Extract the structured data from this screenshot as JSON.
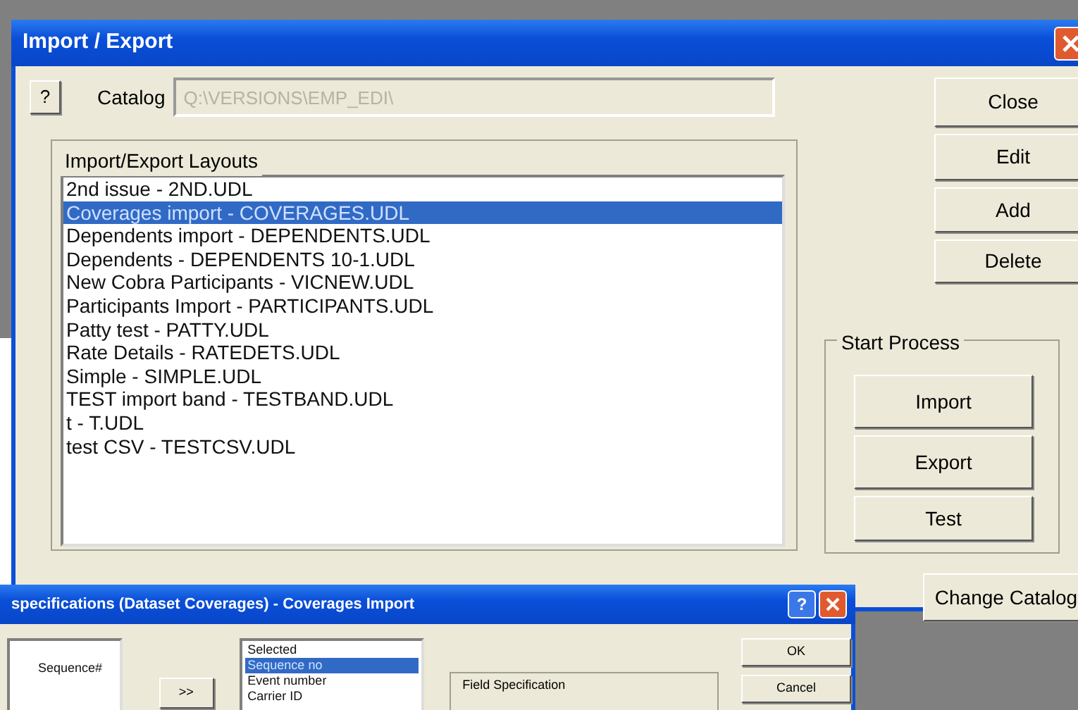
{
  "dialog": {
    "title": "Import / Export",
    "help_button": "?",
    "catalog": {
      "label": "Catalog",
      "value": "Q:\\VERSIONS\\EMP_EDI\\",
      "disabled": true
    },
    "layouts": {
      "title": "Import/Export Layouts",
      "items": [
        {
          "label": "2nd issue - 2ND.UDL",
          "selected": false
        },
        {
          "label": "Coverages import - COVERAGES.UDL",
          "selected": true
        },
        {
          "label": "Dependents import - DEPENDENTS.UDL",
          "selected": false
        },
        {
          "label": "Dependents - DEPENDENTS 10-1.UDL",
          "selected": false
        },
        {
          "label": "New Cobra Participants - VICNEW.UDL",
          "selected": false
        },
        {
          "label": "Participants Import - PARTICIPANTS.UDL",
          "selected": false
        },
        {
          "label": "Patty test - PATTY.UDL",
          "selected": false
        },
        {
          "label": "Rate Details - RATEDETS.UDL",
          "selected": false
        },
        {
          "label": "Simple - SIMPLE.UDL",
          "selected": false
        },
        {
          "label": "TEST import band - TESTBAND.UDL",
          "selected": false
        },
        {
          "label": "t - T.UDL",
          "selected": false
        },
        {
          "label": "test CSV - TESTCSV.UDL",
          "selected": false
        }
      ]
    },
    "buttons": [
      "Close",
      "Edit",
      "Add",
      "Delete"
    ],
    "start_process": {
      "title": "Start Process",
      "buttons": [
        "Import",
        "Export",
        "Test"
      ]
    },
    "change_catalog_button": "Change Catalog"
  },
  "background_dialog": {
    "title": "specifications (Dataset Coverages) - Coverages Import",
    "help_button": "?",
    "available_items": [
      {
        "label": "Sequence#",
        "selected": false
      }
    ],
    "move_button": ">>",
    "selected_list": {
      "title": "Selected",
      "items": [
        {
          "label": "Sequence no",
          "selected": true
        },
        {
          "label": "Event number",
          "selected": false
        },
        {
          "label": "Carrier ID",
          "selected": false
        }
      ]
    },
    "field_specification": {
      "title": "Field Specification"
    },
    "buttons": [
      "OK",
      "Cancel"
    ]
  }
}
